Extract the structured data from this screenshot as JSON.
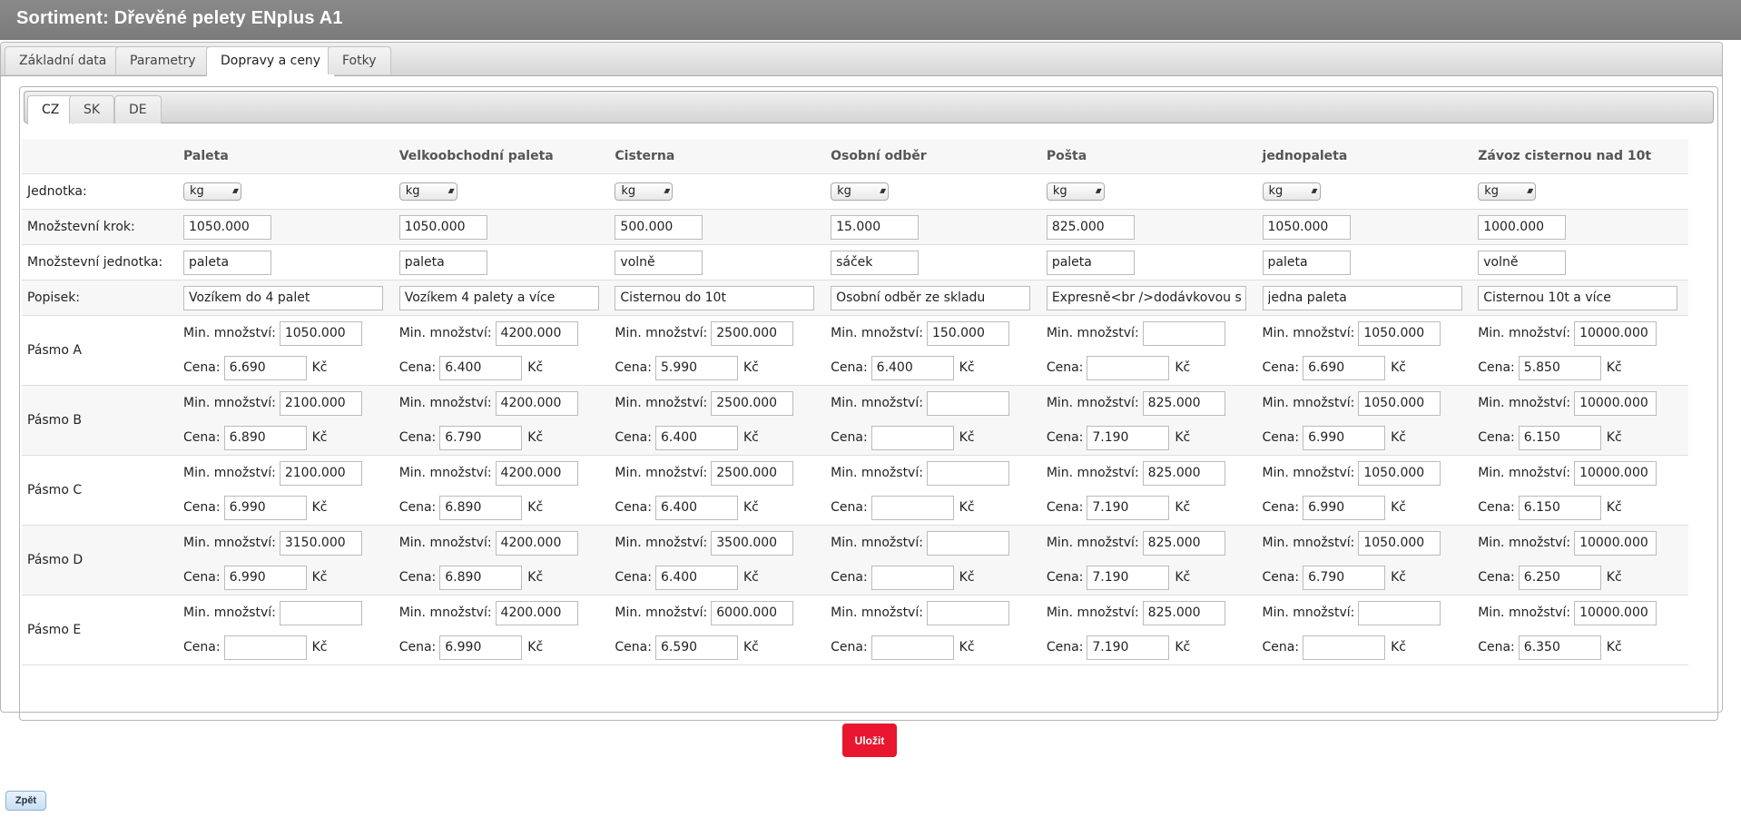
{
  "title": "Sortiment:  Dřevěné pelety ENplus A1",
  "tabs": [
    "Základní data",
    "Parametry",
    "Dopravy a ceny",
    "Fotky"
  ],
  "active_tab": 2,
  "country_tabs": [
    "CZ",
    "SK",
    "DE"
  ],
  "active_country_tab": 0,
  "labels": {
    "jednotka": "Jednotka:",
    "krok": "Množstevní krok:",
    "mnozstevni_jednotka": "Množstevní jednotka:",
    "popisek": "Popisek:",
    "min": "Min. množství:",
    "cena": "Cena:",
    "currency": "Kč"
  },
  "columns": [
    {
      "name": "Paleta",
      "unit": "kg",
      "krok": "1050.000",
      "mj": "paleta",
      "popisek": "Vozíkem do 4 palet"
    },
    {
      "name": "Velkoobchodní paleta",
      "unit": "kg",
      "krok": "1050.000",
      "mj": "paleta",
      "popisek": "Vozíkem 4 palety a více"
    },
    {
      "name": "Cisterna",
      "unit": "kg",
      "krok": "500.000",
      "mj": "volně",
      "popisek": "Cisternou do 10t"
    },
    {
      "name": "Osobní odběr",
      "unit": "kg",
      "krok": "15.000",
      "mj": "sáček",
      "popisek": "Osobní odběr ze skladu"
    },
    {
      "name": "Pošta",
      "unit": "kg",
      "krok": "825.000",
      "mj": "paleta",
      "popisek": "Expresně<br />dodávkovou slu"
    },
    {
      "name": "jednopaleta",
      "unit": "kg",
      "krok": "1050.000",
      "mj": "paleta",
      "popisek": "jedna paleta"
    },
    {
      "name": "Závoz cisternou nad 10t",
      "unit": "kg",
      "krok": "1000.000",
      "mj": "volně",
      "popisek": "Cisternou 10t a více"
    }
  ],
  "bands": [
    {
      "label": "Pásmo A",
      "min": [
        "1050.000",
        "4200.000",
        "2500.000",
        "150.000",
        "",
        "1050.000",
        "10000.000"
      ],
      "cena": [
        "6.690",
        "6.400",
        "5.990",
        "6.400",
        "",
        "6.690",
        "5.850"
      ]
    },
    {
      "label": "Pásmo B",
      "min": [
        "2100.000",
        "4200.000",
        "2500.000",
        "",
        "825.000",
        "1050.000",
        "10000.000"
      ],
      "cena": [
        "6.890",
        "6.790",
        "6.400",
        "",
        "7.190",
        "6.990",
        "6.150"
      ]
    },
    {
      "label": "Pásmo C",
      "min": [
        "2100.000",
        "4200.000",
        "2500.000",
        "",
        "825.000",
        "1050.000",
        "10000.000"
      ],
      "cena": [
        "6.990",
        "6.890",
        "6.400",
        "",
        "7.190",
        "6.990",
        "6.150"
      ]
    },
    {
      "label": "Pásmo D",
      "min": [
        "3150.000",
        "4200.000",
        "3500.000",
        "",
        "825.000",
        "1050.000",
        "10000.000"
      ],
      "cena": [
        "6.990",
        "6.890",
        "6.400",
        "",
        "7.190",
        "6.790",
        "6.250"
      ]
    },
    {
      "label": "Pásmo E",
      "min": [
        "",
        "4200.000",
        "6000.000",
        "",
        "825.000",
        "",
        "10000.000"
      ],
      "cena": [
        "",
        "6.990",
        "6.590",
        "",
        "7.190",
        "",
        "6.350"
      ]
    }
  ],
  "save_label": "Uložit",
  "back_label": "Zpět"
}
